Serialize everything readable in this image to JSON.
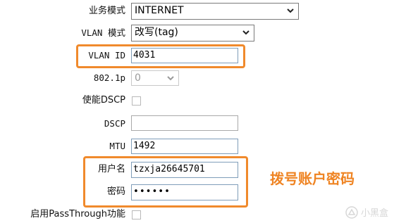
{
  "form": {
    "service_mode": {
      "label": "业务模式",
      "value": "INTERNET"
    },
    "vlan_mode": {
      "label": "VLAN 模式",
      "value": "改写(tag)"
    },
    "vlan_id": {
      "label": "VLAN ID",
      "value": "4031"
    },
    "priority_8021p": {
      "label": "802.1p",
      "value": "0",
      "disabled": true
    },
    "enable_dscp": {
      "label": "使能DSCP",
      "checked": false
    },
    "dscp": {
      "label": "DSCP",
      "value": ""
    },
    "mtu": {
      "label": "MTU",
      "value": "1492"
    },
    "username": {
      "label": "用户名",
      "value": "tzxja26645701"
    },
    "password": {
      "label": "密码",
      "value": "••••••"
    },
    "passthrough": {
      "label": "启用PassThrough功能",
      "checked": false
    }
  },
  "annotation": {
    "text": "拨号账户密码",
    "color": "#f08a2c"
  },
  "watermark": {
    "text": "小黑盒"
  },
  "icons": {
    "select_arrow": "chevron-down-icon",
    "watermark_logo": "xiaoheihe-logo-icon"
  }
}
